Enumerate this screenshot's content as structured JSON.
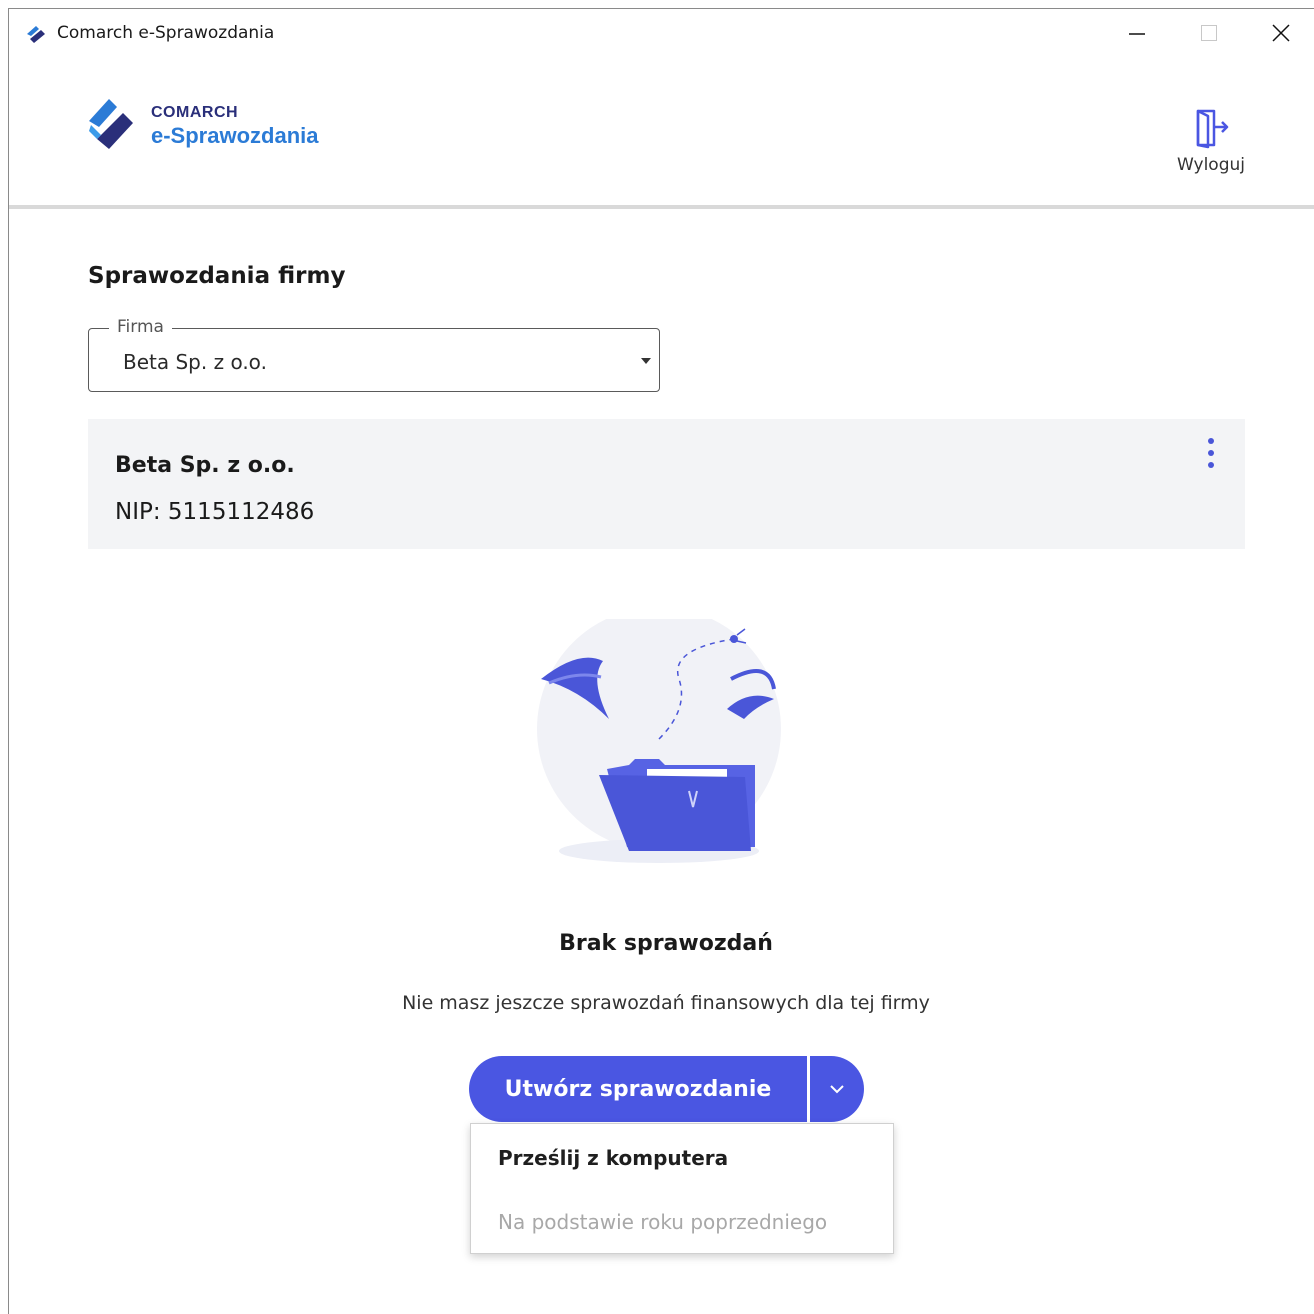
{
  "window": {
    "title": "Comarch e-Sprawozdania",
    "controls": {
      "minimize_icon": "minimize-icon",
      "maximize_icon": "maximize-icon",
      "close_icon": "close-icon"
    }
  },
  "header": {
    "logo_brand": "COMARCH",
    "logo_product": "e-Sprawozdania",
    "logout_label": "Wyloguj",
    "logout_icon": "logout-door-icon"
  },
  "main": {
    "section_title": "Sprawozdania firmy",
    "firma_select": {
      "legend": "Firma",
      "value": "Beta Sp. z o.o."
    },
    "company": {
      "name": "Beta Sp. z o.o.",
      "nip": "NIP: 5115112486"
    },
    "empty_state": {
      "title": "Brak sprawozdań",
      "description": "Nie masz jeszcze sprawozdań finansowych dla tej firmy"
    },
    "create_button": {
      "label": "Utwórz sprawozdanie"
    },
    "dropdown_menu": {
      "items": [
        {
          "label": "Prześlij z komputera",
          "enabled": true
        },
        {
          "label": "Na podstawie roku poprzedniego",
          "enabled": false
        }
      ]
    }
  },
  "colors": {
    "accent": "#4a56e2",
    "logo_dark": "#2a2f7a",
    "logo_light": "#2b7bd6",
    "card_bg": "#f3f4f6",
    "disabled_text": "#a8a8a8"
  }
}
